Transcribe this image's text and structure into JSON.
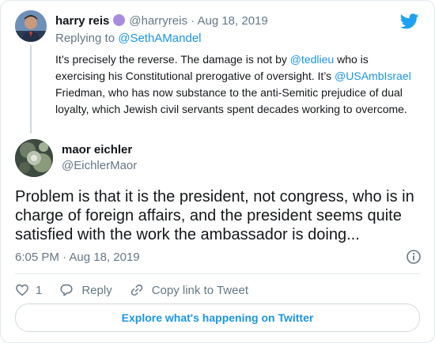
{
  "parent_tweet": {
    "name": "harry reis",
    "handle": "@harryreis",
    "separator": "·",
    "date": "Aug 18, 2019",
    "replying_label": "Replying to",
    "replying_handle": "@SethAMandel",
    "text": {
      "p1": "It’s precisely the reverse. The damage is not by ",
      "mention1": "@tedlieu",
      "p2": " who is exercising his Constitutional prerogative of oversight. It’s ",
      "mention2": "@USAmbIsrael",
      "p3": " Friedman, who has now substance to the anti-Semitic prejudice of dual loyalty, which Jewish civil servants spent decades working to overcome."
    }
  },
  "main_tweet": {
    "name": "maor eichler",
    "handle": "@EichlerMaor",
    "text": "Problem is that it is the president, not congress, who is in charge of foreign affairs, and the president seems quite satisfied with the work the ambassador is doing...",
    "time": "6:05 PM",
    "separator": "·",
    "date": "Aug 18, 2019"
  },
  "actions": {
    "like_count": "1",
    "reply_label": "Reply",
    "copy_label": "Copy link to Tweet"
  },
  "explore_label": "Explore what's happening on Twitter",
  "colors": {
    "accent": "#1b95e0",
    "muted": "#657786",
    "badge": "#a98ddc"
  },
  "icons": [
    "twitter-logo-icon",
    "verified-badge-icon",
    "info-icon",
    "heart-icon",
    "reply-icon",
    "link-icon"
  ]
}
